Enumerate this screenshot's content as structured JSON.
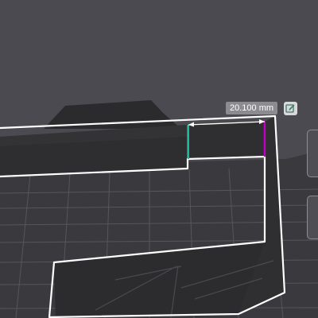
{
  "measurement": {
    "value_label": "20.100 mm"
  },
  "icons": {
    "edit": "edit-pencil-icon"
  },
  "colors": {
    "viewport_background": "#4b4a50",
    "build_plate": "#3a393e",
    "grid_line": "#57565c",
    "model_face": "#2d2d2f",
    "outline": "#ffffff",
    "measure_start_marker": "#1abc9c",
    "measure_end_marker": "#c000c0",
    "label_background": "#8c8b90"
  }
}
